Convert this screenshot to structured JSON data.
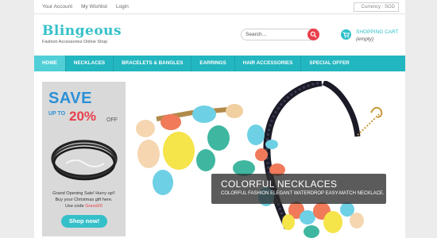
{
  "topbar": {
    "links": [
      "Your Account",
      "My Wishlist",
      "Login"
    ],
    "currency": "Currency : SGD"
  },
  "logo": {
    "title": "Blingeous",
    "tagline": "Fashion Accessories Online Shop"
  },
  "search": {
    "placeholder": "Search..."
  },
  "cart": {
    "label": "SHOPPING CART",
    "status": "(empty)"
  },
  "nav": {
    "items": [
      "HOME",
      "NECKLACES",
      "BRACELETS & BANGLES",
      "EARRINGS",
      "HAIR ACCESSORIES",
      "SPECIAL OFFER"
    ],
    "active": "HOME"
  },
  "promo": {
    "save": "SAVE",
    "up_to": "UP TO",
    "percent": "20%",
    "off": "OFF",
    "line1": "Grand Opening Sale! Hurry up!!",
    "line2": "Buy your Christmas gift here.",
    "code_prefix": "Use code",
    "code": "Grand20",
    "button": "Shop now!"
  },
  "hero": {
    "title": "COLORFUL NECKLACES",
    "subtitle": "COLORFUL FASHION ELEGANT WATERDROP EASY-MATCH NECKLACE."
  },
  "colors": {
    "accent": "#22b6c0",
    "accent_light": "#50cfd7",
    "sale_red": "#e8404c",
    "save_blue": "#2a90d8"
  },
  "icons": [
    "search-icon",
    "shopping-cart-icon"
  ]
}
